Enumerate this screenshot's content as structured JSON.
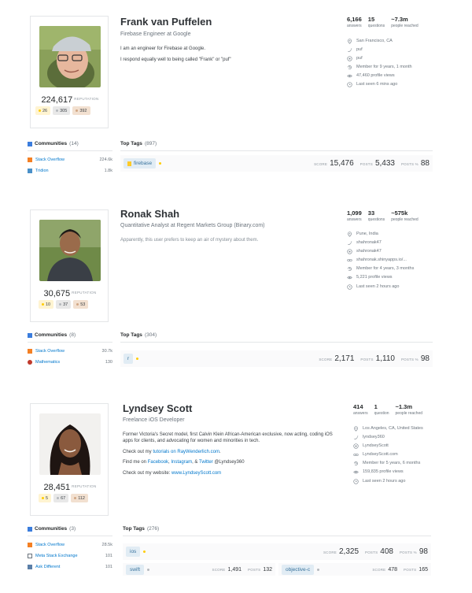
{
  "profiles": [
    {
      "name": "Frank van Puffelen",
      "title": "Firebase Engineer at Google",
      "bio": [
        "I am an engineer for Firebase at Google.",
        "I respond equally well to being called \"Frank\" or \"puf\""
      ],
      "reputation": "224,617",
      "reputation_label": "REPUTATION",
      "badges": {
        "gold": "26",
        "silver": "305",
        "bronze": "392"
      },
      "stats": {
        "answers": "6,166",
        "answers_label": "answers",
        "questions": "15",
        "questions_label": "questions",
        "reached": "~7.3m",
        "reached_label": "people reached"
      },
      "meta": {
        "location": "San Francisco, CA",
        "twitter": "puf",
        "github": "puf",
        "member": "Member for 9 years, 1 month",
        "views": "47,460 profile views",
        "seen": "Last seen 6 mins ago"
      },
      "communities_label": "Communities",
      "communities_count": "(14)",
      "communities": [
        {
          "name": "Stack Overflow",
          "rep": "224.6k"
        },
        {
          "name": "Tridion",
          "rep": "1.8k"
        }
      ],
      "top_tags_label": "Top Tags",
      "top_tags_count": "(897)",
      "tags": [
        {
          "name": "firebase",
          "score": "15,476",
          "posts": "5,433",
          "posts_pct": "88"
        }
      ]
    },
    {
      "name": "Ronak Shah",
      "title": "Quantitative Analyst at Regent Markets Group (Binary.com)",
      "bio": [
        "Apparently, this user prefers to keep an air of mystery about them."
      ],
      "reputation": "30,675",
      "reputation_label": "REPUTATION",
      "badges": {
        "gold": "10",
        "silver": "37",
        "bronze": "53"
      },
      "stats": {
        "answers": "1,099",
        "answers_label": "answers",
        "questions": "33",
        "questions_label": "questions",
        "reached": "~575k",
        "reached_label": "people reached"
      },
      "meta": {
        "location": "Pune, India",
        "twitter": "shahronak47",
        "github": "shahronak47",
        "website": "shahronak.shinyapps.io/...",
        "member": "Member for 4 years, 3 months",
        "views": "5,221 profile views",
        "seen": "Last seen 2 hours ago"
      },
      "communities_label": "Communities",
      "communities_count": "(8)",
      "communities": [
        {
          "name": "Stack Overflow",
          "rep": "30.7k"
        },
        {
          "name": "Mathematics",
          "rep": "130"
        }
      ],
      "top_tags_label": "Top Tags",
      "top_tags_count": "(304)",
      "tags": [
        {
          "name": "r",
          "score": "2,171",
          "posts": "1,110",
          "posts_pct": "98"
        }
      ]
    },
    {
      "name": "Lyndsey Scott",
      "title": "Freelance iOS Developer",
      "bio_intro": "Former Victoria's Secret model, first Calvin Klein African-American exclusive, now acting, coding iOS apps for clients, and advocating for women and minorities in tech.",
      "bio_tutorials_prefix": "Check out my",
      "bio_tutorials_link": "tutorials on RayWenderlich.com",
      "bio_find_prefix": "Find me on",
      "bio_facebook": "Facebook",
      "bio_instagram": "Instagram",
      "bio_and": ", &",
      "bio_twitter": "Twitter",
      "bio_twitter_handle": "@Lyndsey360",
      "bio_website_prefix": "Check out my website:",
      "bio_website": "www.LyndseyScott.com",
      "reputation": "28,451",
      "reputation_label": "REPUTATION",
      "badges": {
        "gold": "5",
        "silver": "67",
        "bronze": "112"
      },
      "stats": {
        "answers": "414",
        "answers_label": "answers",
        "questions": "1",
        "questions_label": "question",
        "reached": "~1.3m",
        "reached_label": "people reached"
      },
      "meta": {
        "location": "Los Angeles, CA, United States",
        "twitter": "lyndsey360",
        "github": "LyndseyScott",
        "website": "LyndseyScott.com",
        "member": "Member for 5 years, 6 months",
        "views": "159,835 profile views",
        "seen": "Last seen 2 hours ago"
      },
      "communities_label": "Communities",
      "communities_count": "(3)",
      "communities": [
        {
          "name": "Stack Overflow",
          "rep": "28.5k"
        },
        {
          "name": "Meta Stack Exchange",
          "rep": "101"
        },
        {
          "name": "Ask Different",
          "rep": "101"
        }
      ],
      "top_tags_label": "Top Tags",
      "top_tags_count": "(276)",
      "tags": [
        {
          "name": "ios",
          "score": "2,325",
          "posts": "408",
          "posts_pct": "98"
        },
        {
          "name": "swift",
          "score": "1,491",
          "posts": "132"
        },
        {
          "name": "objective-c",
          "score": "478",
          "posts": "165"
        }
      ]
    }
  ],
  "labels": {
    "score": "SCORE",
    "posts": "POSTS",
    "posts_pct": "POSTS %"
  },
  "colors": {
    "link": "#0077cc",
    "gold": "#ffcc01",
    "silver": "#b4b8bc",
    "bronze": "#d1a684",
    "tag_bg": "#e1ecf4"
  }
}
